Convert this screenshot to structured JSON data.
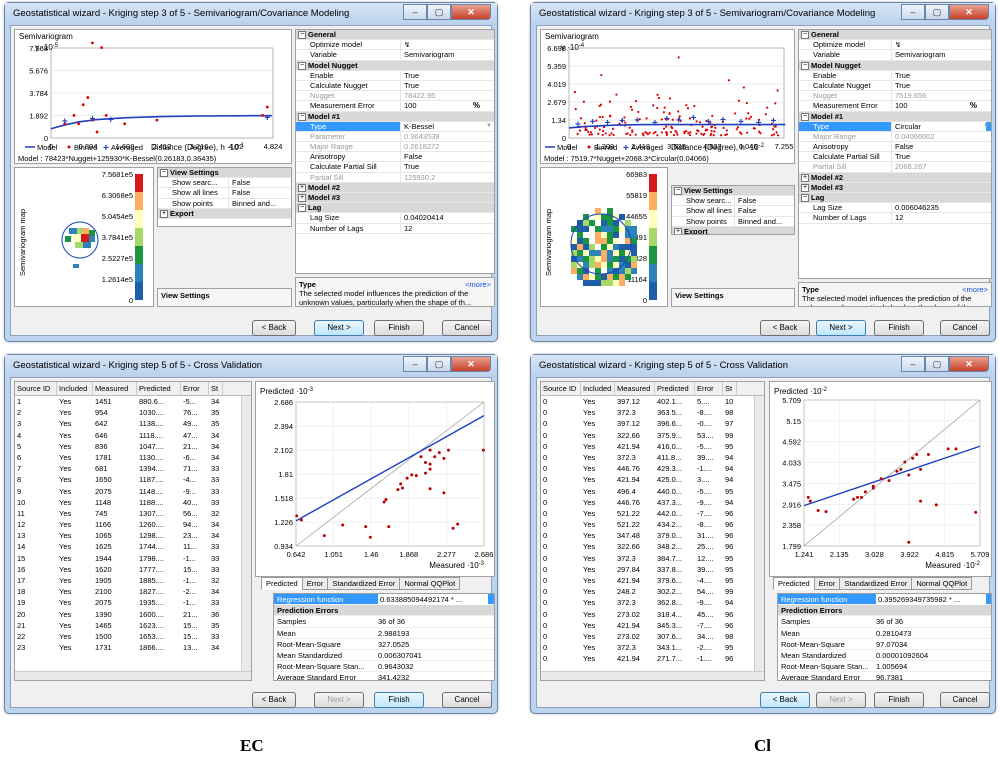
{
  "captions": {
    "left": "EC",
    "right": "Cl"
  },
  "common": {
    "win_buttons": {
      "min": "‒",
      "max": "▢",
      "close": "✕"
    },
    "semivariogram_title": "Semivariogram",
    "legend": {
      "model": "Model",
      "binned": "Binned",
      "averaged": "Averaged"
    },
    "map_label": "Semivariogram map",
    "help_title": "Type",
    "help_more": "<more>",
    "help_text": "The selected model influences the prediction of the unknown values, particularly when the shape of th...",
    "view_settings": "View Settings",
    "view_settings_bar": "View Settings",
    "export": "Export",
    "show_search": "Show searc...",
    "show_all_lines": "Show all lines",
    "show_points": "Show points",
    "back": "< Back",
    "next": "Next >",
    "finish": "Finish",
    "cancel": "Cancel",
    "sec_general": "General",
    "sec_nugget": "Model Nugget",
    "sec_model1": "Model #1",
    "sec_model2": "Model #2",
    "sec_model3": "Model #3",
    "sec_lag": "Lag",
    "k_optimize": "Optimize model",
    "k_variable": "Variable",
    "k_enable": "Enable",
    "k_calc_nugget": "Calculate Nugget",
    "k_nugget": "Nugget",
    "k_meas_err": "Measurement Error",
    "k_type": "Type",
    "k_parameter": "Parameter",
    "k_major": "Major Range",
    "k_aniso": "Anisotropy",
    "k_calc_sill": "Calculate Partial Sill",
    "k_sill": "Partial Sill",
    "k_lag_size": "Lag Size",
    "k_num_lags": "Number of Lags",
    "pct": "%",
    "predicted_axis": "Predicted",
    "measured_axis": "Measured",
    "tab_predicted": "Predicted",
    "tab_error": "Error",
    "tab_std_error": "Standardized Error",
    "tab_qq": "Normal QQPlot",
    "col_source": "Source ID",
    "col_included": "Included",
    "col_measured": "Measured",
    "col_predicted": "Predicted",
    "col_error": "Error",
    "col_st": "St",
    "k_regression": "Regression function",
    "k_pred_errors": "Prediction Errors",
    "k_samples": "Samples",
    "k_mean": "Mean",
    "k_rms": "Root-Mean-Square",
    "k_mean_std": "Mean Standardized",
    "k_rms_std": "Root-Mean-Square Stan...",
    "k_avg_std_err": "Average Standard Error"
  },
  "ec_step3": {
    "title": "Geostatistical wizard - Kriging step 3 of 5 - Semivariogram/Covariance Modeling",
    "y_unit": "γ ·10-5",
    "x_unit": "Distance (Degree), h ·10-1",
    "y_ticks": [
      "7.568",
      "5.676",
      "3.784",
      "1.892",
      "0"
    ],
    "x_ticks": [
      "0",
      "0.804",
      "1.608",
      "2.412",
      "3.216",
      "4.02",
      "4.824"
    ],
    "formula": "Model : 78423*Nugget+125930*K-Bessel(0.26183,0.36435)",
    "map_ticks": [
      "7.5681e5",
      "6.3068e5",
      "5.0454e5",
      "3.7841e5",
      "2.5227e5",
      "1.2614e5",
      "0"
    ],
    "show_search_val": "False",
    "show_all_lines_val": "False",
    "show_points_val": "Binned and...",
    "optimize_icon": "optimize-icon",
    "variable": "Semivariogram",
    "enable": "True",
    "calc_nugget": "True",
    "nugget": "78422.95",
    "meas_err": "100",
    "type": "K-Bessel",
    "parameter": "0.3643539",
    "major_range": "0.2618272",
    "anisotropy": "False",
    "calc_sill": "True",
    "partial_sill": "125930.2",
    "lag_size": "0.04020414",
    "num_lags": "12",
    "binned": [
      [
        0.5,
        1.9
      ],
      [
        0.7,
        2.8
      ],
      [
        0.9,
        8.0
      ],
      [
        1.1,
        7.6
      ],
      [
        0.6,
        1.2
      ],
      [
        0.9,
        1.5
      ],
      [
        1.2,
        1.9
      ],
      [
        1.6,
        1.2
      ],
      [
        2.3,
        1.5
      ],
      [
        0.3,
        1.2
      ],
      [
        1.0,
        0.5
      ],
      [
        0.8,
        3.4
      ],
      [
        4.7,
        2.6
      ],
      [
        4.6,
        1.9
      ]
    ],
    "averaged": [
      [
        0.3,
        1.4
      ],
      [
        0.9,
        1.6
      ],
      [
        1.3,
        1.5
      ],
      [
        4.7,
        1.7
      ]
    ],
    "model_curve": [
      [
        0,
        0.78
      ],
      [
        0.3,
        1.1
      ],
      [
        0.6,
        1.35
      ],
      [
        1,
        1.55
      ],
      [
        1.6,
        1.7
      ],
      [
        2.4,
        1.8
      ],
      [
        3.2,
        1.85
      ],
      [
        4.8,
        1.88
      ]
    ]
  },
  "cl_step3": {
    "title": "Geostatistical wizard - Kriging step 3 of 5 - Semivariogram/Covariance Modeling",
    "y_unit": "γ ·10-4",
    "x_unit": "Distance (Degree), h ·10-2",
    "y_ticks": [
      "6.698",
      "5.359",
      "4.019",
      "2.679",
      "1.34",
      "0"
    ],
    "x_ticks": [
      "0",
      "1.209",
      "2.418",
      "3.628",
      "4.837",
      "6.046",
      "7.255"
    ],
    "formula": "Model : 7519.7*Nugget+2068.3*Circular(0.04066)",
    "map_ticks": [
      "66983",
      "55819",
      "44655",
      "33491",
      "22328",
      "11164",
      "0"
    ],
    "show_search_val": "False",
    "show_all_lines_val": "False",
    "show_points_val": "Binned and...",
    "optimize_icon": "optimize-icon",
    "variable": "Semivariogram",
    "enable": "True",
    "calc_nugget": "True",
    "nugget": "7519.656",
    "meas_err": "100",
    "type": "Circular",
    "major_range": "0.04066002",
    "anisotropy": "False",
    "calc_sill": "True",
    "partial_sill": "2068.267",
    "lag_size": "0.006046235",
    "num_lags": "12",
    "model_curve": [
      [
        0,
        0.75
      ],
      [
        0.5,
        0.85
      ],
      [
        1.5,
        0.95
      ],
      [
        2.5,
        1.0
      ],
      [
        4,
        1.0
      ],
      [
        7.3,
        1.0
      ]
    ]
  },
  "ec_step5": {
    "title": "Geostatistical wizard - Kriging step 5 of 5 - Cross Validation",
    "rows": [
      [
        "1",
        "Yes",
        "1451",
        "880.6...",
        "-5...",
        "34"
      ],
      [
        "2",
        "Yes",
        "954",
        "1030....",
        "76...",
        "35"
      ],
      [
        "3",
        "Yes",
        "642",
        "1138....",
        "49...",
        "35"
      ],
      [
        "4",
        "Yes",
        "646",
        "1118....",
        "47...",
        "34"
      ],
      [
        "5",
        "Yes",
        "836",
        "1047....",
        "21...",
        "34"
      ],
      [
        "6",
        "Yes",
        "1781",
        "1130....",
        "-6...",
        "34"
      ],
      [
        "7",
        "Yes",
        "681",
        "1394....",
        "71...",
        "33"
      ],
      [
        "8",
        "Yes",
        "1650",
        "1187....",
        "-4...",
        "33"
      ],
      [
        "9",
        "Yes",
        "2075",
        "1148....",
        "-9...",
        "33"
      ],
      [
        "10",
        "Yes",
        "1148",
        "1188....",
        "40...",
        "33"
      ],
      [
        "11",
        "Yes",
        "745",
        "1307....",
        "56...",
        "32"
      ],
      [
        "12",
        "Yes",
        "1166",
        "1260....",
        "94...",
        "34"
      ],
      [
        "13",
        "Yes",
        "1065",
        "1298....",
        "23...",
        "34"
      ],
      [
        "14",
        "Yes",
        "1625",
        "1744....",
        "11...",
        "33"
      ],
      [
        "15",
        "Yes",
        "1944",
        "1798....",
        "-1...",
        "33"
      ],
      [
        "16",
        "Yes",
        "1620",
        "1777....",
        "15...",
        "33"
      ],
      [
        "17",
        "Yes",
        "1905",
        "1885....",
        "-1...",
        "32"
      ],
      [
        "18",
        "Yes",
        "2100",
        "1827....",
        "-2...",
        "34"
      ],
      [
        "19",
        "Yes",
        "2075",
        "1935....",
        "-1...",
        "33"
      ],
      [
        "20",
        "Yes",
        "1390",
        "1600....",
        "21...",
        "36"
      ],
      [
        "21",
        "Yes",
        "1465",
        "1623....",
        "15...",
        "35"
      ],
      [
        "22",
        "Yes",
        "1500",
        "1653....",
        "15...",
        "33"
      ],
      [
        "23",
        "Yes",
        "1731",
        "1866....",
        "13...",
        "34"
      ]
    ],
    "y_unit": "·10-3",
    "x_unit": "·10-3",
    "y_ticks": [
      "2.686",
      "2.394",
      "2.102",
      "1.81",
      "1.518",
      "1.226",
      "0.934"
    ],
    "x_ticks": [
      "0.642",
      "1.051",
      "1.46",
      "1.868",
      "2.277",
      "2.686"
    ],
    "regression": "0.633885094492174 * ...",
    "samples": "36 of 36",
    "mean": "2.988193",
    "rms": "327.0525",
    "mean_std": "0.006307041",
    "rms_std": "0.9643032",
    "avg_std_err": "341.4232",
    "points": [
      [
        0.65,
        1.3
      ],
      [
        0.7,
        1.25
      ],
      [
        0.95,
        1.06
      ],
      [
        1.15,
        1.19
      ],
      [
        1.45,
        1.04
      ],
      [
        1.4,
        1.17
      ],
      [
        1.6,
        1.47
      ],
      [
        1.62,
        1.5
      ],
      [
        1.65,
        1.17
      ],
      [
        1.75,
        1.62
      ],
      [
        1.78,
        1.69
      ],
      [
        1.8,
        1.64
      ],
      [
        1.85,
        1.76
      ],
      [
        1.9,
        1.8
      ],
      [
        1.95,
        1.79
      ],
      [
        2.0,
        2.02
      ],
      [
        2.05,
        1.82
      ],
      [
        2.1,
        1.87
      ],
      [
        2.1,
        2.1
      ],
      [
        2.05,
        1.95
      ],
      [
        2.15,
        2.02
      ],
      [
        2.2,
        2.07
      ],
      [
        2.25,
        2.0
      ],
      [
        2.1,
        1.63
      ],
      [
        2.25,
        1.58
      ],
      [
        2.35,
        1.15
      ],
      [
        2.4,
        1.2
      ],
      [
        2.1,
        1.93
      ],
      [
        2.3,
        2.1
      ],
      [
        2.68,
        2.1
      ]
    ],
    "reg_line": [
      [
        0.642,
        1.24
      ],
      [
        2.686,
        2.52
      ]
    ]
  },
  "cl_step5": {
    "title": "Geostatistical wizard - Kriging step 5 of 5 - Cross Validation",
    "rows": [
      [
        "0",
        "Yes",
        "397.12",
        "402.1...",
        "5....",
        "10"
      ],
      [
        "0",
        "Yes",
        "372.3",
        "363.5...",
        "-8....",
        "98"
      ],
      [
        "0",
        "Yes",
        "397.12",
        "396.6...",
        "-0....",
        "97"
      ],
      [
        "0",
        "Yes",
        "322.66",
        "375.9...",
        "53....",
        "99"
      ],
      [
        "0",
        "Yes",
        "421.94",
        "416.0...",
        "-5....",
        "95"
      ],
      [
        "0",
        "Yes",
        "372.3",
        "411.8...",
        "39....",
        "94"
      ],
      [
        "0",
        "Yes",
        "446.76",
        "429.3...",
        "-1....",
        "94"
      ],
      [
        "0",
        "Yes",
        "421.94",
        "425.0...",
        "3....",
        "94"
      ],
      [
        "0",
        "Yes",
        "496.4",
        "440.0...",
        "-5....",
        "95"
      ],
      [
        "0",
        "Yes",
        "446.76",
        "437.3...",
        "-9....",
        "94"
      ],
      [
        "0",
        "Yes",
        "521.22",
        "442.0...",
        "-7....",
        "96"
      ],
      [
        "0",
        "Yes",
        "521.22",
        "434.2...",
        "-8....",
        "96"
      ],
      [
        "0",
        "Yes",
        "347.48",
        "379.0...",
        "31....",
        "96"
      ],
      [
        "0",
        "Yes",
        "322.66",
        "348.2...",
        "25....",
        "96"
      ],
      [
        "0",
        "Yes",
        "372.3",
        "384.7...",
        "12....",
        "95"
      ],
      [
        "0",
        "Yes",
        "297.84",
        "337.8...",
        "39....",
        "95"
      ],
      [
        "0",
        "Yes",
        "421.94",
        "379.6...",
        "-4....",
        "95"
      ],
      [
        "0",
        "Yes",
        "248.2",
        "302.2...",
        "54....",
        "99"
      ],
      [
        "0",
        "Yes",
        "372.3",
        "362.8...",
        "-9....",
        "94"
      ],
      [
        "0",
        "Yes",
        "273.02",
        "318.4...",
        "45....",
        "96"
      ],
      [
        "0",
        "Yes",
        "421.94",
        "345.3...",
        "-7....",
        "96"
      ],
      [
        "0",
        "Yes",
        "273.02",
        "307.6...",
        "34....",
        "98"
      ],
      [
        "0",
        "Yes",
        "372.3",
        "343.1...",
        "-2....",
        "95"
      ],
      [
        "0",
        "Yes",
        "421.94",
        "271.7...",
        "-1....",
        "96"
      ]
    ],
    "y_unit": "·10-2",
    "x_unit": "·10-2",
    "y_ticks": [
      "5.709",
      "5.15",
      "4.592",
      "4.033",
      "3.475",
      "2.916",
      "2.358",
      "1.799"
    ],
    "x_ticks": [
      "1.241",
      "2.135",
      "3.028",
      "3.922",
      "4.815",
      "5.709"
    ],
    "regression": "0.395269349735982 * ...",
    "samples": "36 of 36",
    "mean": "0.2810473",
    "rms": "97.07034",
    "mean_std": "0.00001092604",
    "rms_std": "1.005694",
    "avg_std_err": "96.7381",
    "points": [
      [
        1.35,
        3.1
      ],
      [
        1.4,
        3.0
      ],
      [
        1.6,
        2.75
      ],
      [
        1.8,
        2.72
      ],
      [
        2.5,
        3.05
      ],
      [
        2.6,
        3.1
      ],
      [
        2.7,
        3.1
      ],
      [
        2.8,
        3.25
      ],
      [
        3.0,
        3.4
      ],
      [
        3.2,
        3.6
      ],
      [
        3.4,
        3.55
      ],
      [
        3.6,
        3.8
      ],
      [
        3.7,
        3.85
      ],
      [
        3.8,
        4.05
      ],
      [
        3.9,
        3.7
      ],
      [
        4.0,
        4.15
      ],
      [
        4.1,
        4.25
      ],
      [
        4.2,
        3.85
      ],
      [
        4.2,
        3.0
      ],
      [
        4.4,
        4.25
      ],
      [
        4.6,
        2.9
      ],
      [
        4.9,
        4.4
      ],
      [
        5.1,
        4.4
      ],
      [
        5.6,
        2.7
      ],
      [
        3.9,
        1.9
      ],
      [
        3.0,
        3.35
      ]
    ],
    "reg_line": [
      [
        1.241,
        2.88
      ],
      [
        5.709,
        4.47
      ]
    ]
  }
}
